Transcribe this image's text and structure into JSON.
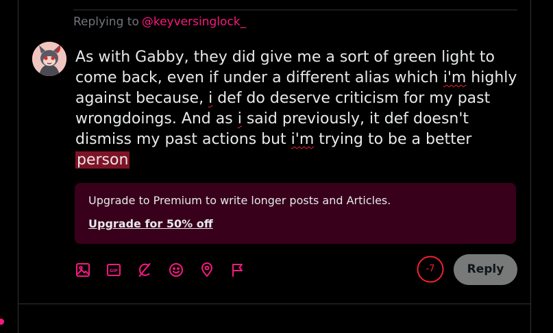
{
  "colors": {
    "accent": "#f91880",
    "counter_over_limit": "#f4212e",
    "premium_bg": "#38001b",
    "selection": "#7f1325"
  },
  "reply_context": {
    "prefix": "Replying to",
    "handle": "@keyversinglock_"
  },
  "post": {
    "segments": [
      "As with Gabby, they did give me a sort of green light to come back, even if under a different alias which ",
      "i'm",
      " highly against because, ",
      "i",
      " def do deserve criticism for my past wrongdoings. And as ",
      "i",
      " said previously, it def doesn't dismiss my past actions but ",
      "i'm",
      " trying to be a better",
      "person"
    ]
  },
  "premium_upsell": {
    "message": "Upgrade to Premium to write longer posts and Articles.",
    "cta": "Upgrade for 50% off"
  },
  "toolbar": {
    "icons": [
      "media-icon",
      "gif-icon",
      "grok-icon",
      "emoji-icon",
      "location-icon",
      "flag-icon"
    ]
  },
  "char_counter": "-7",
  "reply_button_label": "Reply"
}
